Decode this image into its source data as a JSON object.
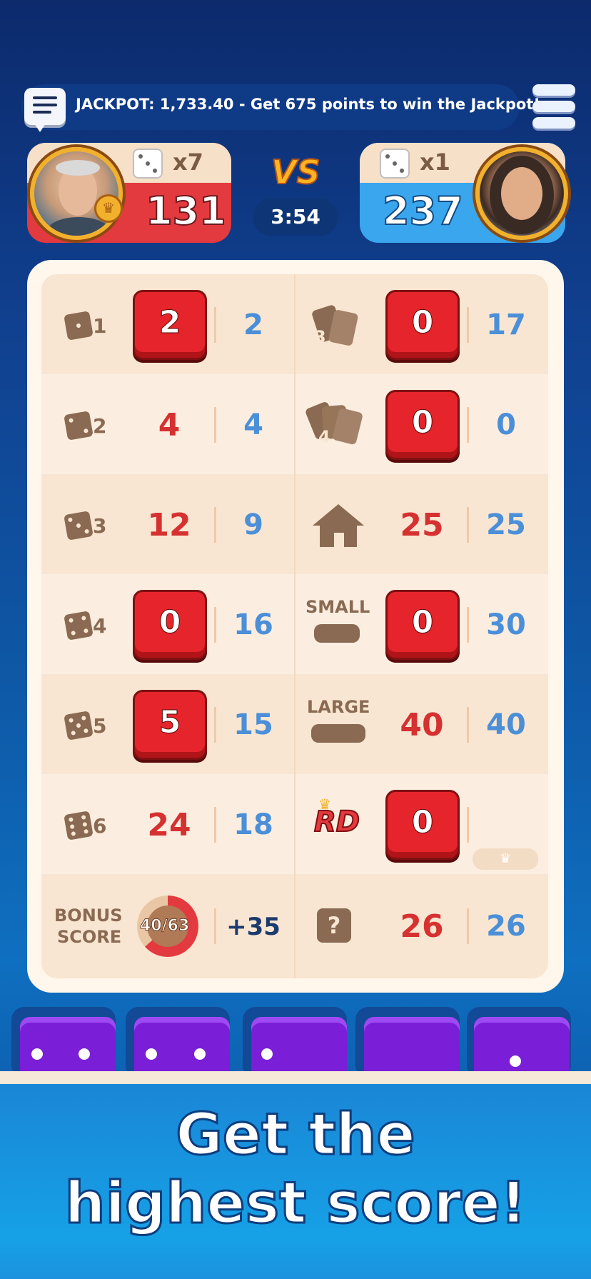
{
  "header": {
    "jackpot_text": "JACKPOT:  1,733.40 - Get 675 points to win the Jackpot!"
  },
  "players": {
    "p1": {
      "dice_multiplier": "x7",
      "score": "131"
    },
    "p2": {
      "dice_multiplier": "x1",
      "score": "237"
    }
  },
  "vs_label": "VS",
  "timer": "3:54",
  "board": {
    "left": [
      {
        "icon_num": "1",
        "player_value": "2",
        "highlighted": true,
        "opponent_value": "2"
      },
      {
        "icon_num": "2",
        "player_value": "4",
        "highlighted": false,
        "opponent_value": "4"
      },
      {
        "icon_num": "3",
        "player_value": "12",
        "highlighted": false,
        "opponent_value": "9"
      },
      {
        "icon_num": "4",
        "player_value": "0",
        "highlighted": true,
        "opponent_value": "16"
      },
      {
        "icon_num": "5",
        "player_value": "5",
        "highlighted": true,
        "opponent_value": "15"
      },
      {
        "icon_num": "6",
        "player_value": "24",
        "highlighted": false,
        "opponent_value": "18"
      }
    ],
    "right": [
      {
        "icon_label": "3",
        "player_value": "0",
        "highlighted": true,
        "opponent_value": "17"
      },
      {
        "icon_label": "4",
        "player_value": "0",
        "highlighted": true,
        "opponent_value": "0"
      },
      {
        "icon_label": "house",
        "player_value": "25",
        "highlighted": false,
        "opponent_value": "25"
      },
      {
        "icon_label": "SMALL",
        "player_value": "0",
        "highlighted": true,
        "opponent_value": "30"
      },
      {
        "icon_label": "LARGE",
        "player_value": "40",
        "highlighted": false,
        "opponent_value": "40"
      },
      {
        "icon_label": "RD",
        "player_value": "0",
        "highlighted": true,
        "opponent_value": ""
      },
      {
        "icon_label": "?",
        "player_value": "26",
        "highlighted": false,
        "opponent_value": "26"
      }
    ],
    "bonus": {
      "label_line1": "BONUS",
      "label_line2": "SCORE",
      "progress": "40/63",
      "progress_fraction": 0.635,
      "bonus_points": "+35"
    }
  },
  "slogan": {
    "line1": "Get the",
    "line2": "highest score!"
  }
}
